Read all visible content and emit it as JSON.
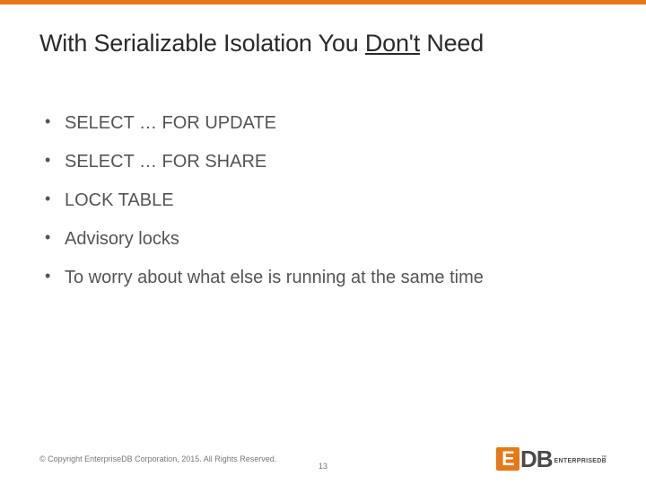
{
  "header": {
    "title_pre": "With Serializable Isolation You ",
    "title_underlined": "Don't",
    "title_post": " Need"
  },
  "bullets": [
    "SELECT … FOR UPDATE",
    "SELECT … FOR SHARE",
    "LOCK TABLE",
    "Advisory locks",
    "To worry about what else is running at the same time"
  ],
  "footer": {
    "copyright": "© Copyright EnterpriseDB Corporation, 2015. All Rights Reserved.",
    "page_number": "13",
    "logo_e": "E",
    "logo_db": "DB",
    "logo_tm": "™",
    "logo_sub": "ENTERPRISEDB"
  }
}
